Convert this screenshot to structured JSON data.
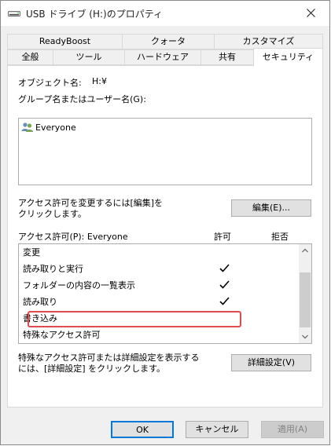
{
  "window": {
    "title": "USB ドライブ (H:)のプロパティ",
    "close_symbol": "✕"
  },
  "tabs": {
    "row_back": [
      {
        "label": "ReadyBoost"
      },
      {
        "label": "クォータ"
      },
      {
        "label": "カスタマイズ"
      }
    ],
    "row_front": [
      {
        "label": "全般"
      },
      {
        "label": "ツール"
      },
      {
        "label": "ハードウェア"
      },
      {
        "label": "共有"
      },
      {
        "label": "セキュリティ",
        "active": true
      }
    ]
  },
  "security": {
    "object_name_label": "オブジェクト名:",
    "object_name_value": "H:¥",
    "groups_label": "グループ名またはユーザー名(G):",
    "users": [
      {
        "name": "Everyone",
        "icon": "users-icon"
      }
    ],
    "edit_hint": "アクセス許可を変更するには[編集]を\nクリックします。",
    "edit_button": "編集(E)...",
    "perm_header": "アクセス許可(P): Everyone",
    "allow_header": "許可",
    "deny_header": "拒否",
    "permissions": [
      {
        "name": "変更",
        "allow": false,
        "deny": false
      },
      {
        "name": "読み取りと実行",
        "allow": true,
        "deny": false
      },
      {
        "name": "フォルダーの内容の一覧表示",
        "allow": true,
        "deny": false
      },
      {
        "name": "読み取り",
        "allow": true,
        "deny": false
      },
      {
        "name": "書き込み",
        "allow": false,
        "deny": false
      },
      {
        "name": "特殊なアクセス許可",
        "allow": false,
        "deny": false
      }
    ],
    "advanced_hint": "特殊なアクセス許可または詳細設定を表示する\nには、[詳細設定] をクリックします。",
    "advanced_button": "詳細設定(V)"
  },
  "footer": {
    "ok": "OK",
    "cancel": "キャンセル",
    "apply": "適用(A)"
  },
  "colors": {
    "highlight": "#e24b4b",
    "button_default_border": "#0078d7"
  }
}
